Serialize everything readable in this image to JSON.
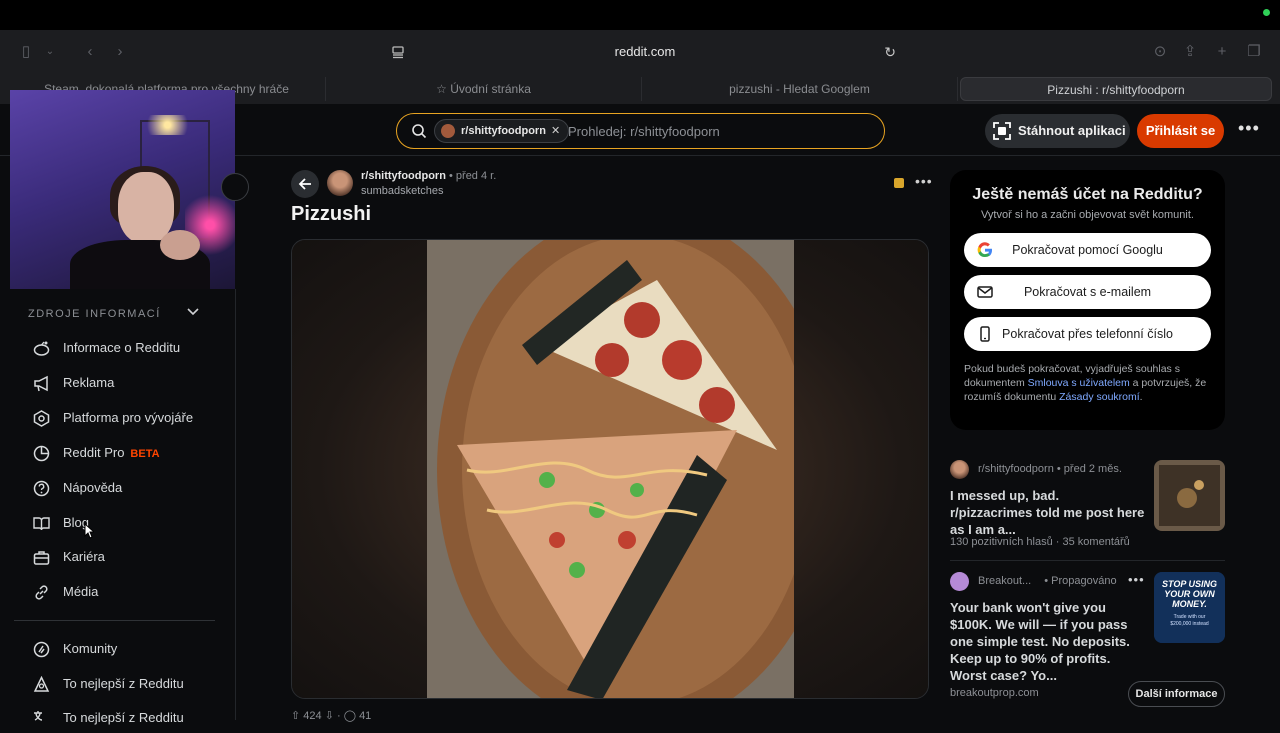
{
  "browser": {
    "url": "reddit.com",
    "tabs": [
      {
        "label": "Steam, dokonalá platforma pro všechny hráče"
      },
      {
        "label": "Úvodní stránka"
      },
      {
        "label": "pizzushi - Hledat Googlem"
      },
      {
        "label": "Pizzushi : r/shittyfoodporn"
      }
    ]
  },
  "header": {
    "search_chip": "r/shittyfoodporn",
    "search_placeholder": "Prohledej: r/shittyfoodporn",
    "get_app": "Stáhnout aplikaci",
    "login": "Přihlásit se"
  },
  "sidebar": {
    "section_title": "ZDROJE INFORMACÍ",
    "items": [
      {
        "label": "Informace o Redditu",
        "icon": "reddit-icon"
      },
      {
        "label": "Reklama",
        "icon": "megaphone-icon"
      },
      {
        "label": "Platforma pro vývojáře",
        "icon": "developer-icon"
      },
      {
        "label": "Reddit Pro",
        "badge": "BETA",
        "icon": "pro-icon"
      },
      {
        "label": "Nápověda",
        "icon": "help-icon"
      },
      {
        "label": "Blog",
        "icon": "book-icon"
      },
      {
        "label": "Kariéra",
        "icon": "briefcase-icon"
      },
      {
        "label": "Média",
        "icon": "link-icon"
      }
    ],
    "items2": [
      {
        "label": "Komunity",
        "icon": "communities-icon"
      },
      {
        "label": "To nejlepší z Redditu",
        "icon": "best-icon"
      },
      {
        "label": "To nejlepší z Redditu",
        "icon": "translate-icon"
      }
    ]
  },
  "post": {
    "subreddit": "r/shittyfoodporn",
    "age": "• před 4 r.",
    "author": "sumbadsketches",
    "title": "Pizzushi",
    "votes": "424",
    "comments": "41"
  },
  "signup": {
    "title": "Ještě nemáš účet na Redditu?",
    "subtitle": "Vytvoř si ho a začni objevovat svět komunit.",
    "google": "Pokračovat pomocí Googlu",
    "email": "Pokračovat s e-mailem",
    "phone": "Pokračovat přes telefonní číslo",
    "legal_1": "Pokud budeš pokračovat, vyjadřuješ souhlas s dokumentem",
    "legal_link_1": "Smlouva s uživatelem",
    "legal_2": "a potvrzuješ, že rozumíš dokumentu",
    "legal_link_2": "Zásady soukromí",
    "legal_end": "."
  },
  "related": [
    {
      "subreddit": "r/shittyfoodporn",
      "age": "• před 2 měs.",
      "title": "I messed up, bad. r/pizzacrimes told me post here as I am a...",
      "upvotes": "130 pozitivních hlasů",
      "comments": "35 komentářů"
    }
  ],
  "ad": {
    "advertiser": "Breakout...",
    "promoted": "• Propagováno",
    "title": "Your bank won't give you $100K. We will — if you pass one simple test. No deposits. Keep up to 90% of profits. Worst case? Yo...",
    "domain": "breakoutprop.com",
    "cta": "Další informace",
    "thumb_line1": "STOP USING",
    "thumb_line2": "YOUR OWN",
    "thumb_line3": "MONEY.",
    "thumb_line4": "Trade with our",
    "thumb_line5": "$200,000 instead"
  },
  "colors": {
    "accent": "#d93a00",
    "search_border": "#e8a422",
    "link": "#7fa9ff"
  }
}
